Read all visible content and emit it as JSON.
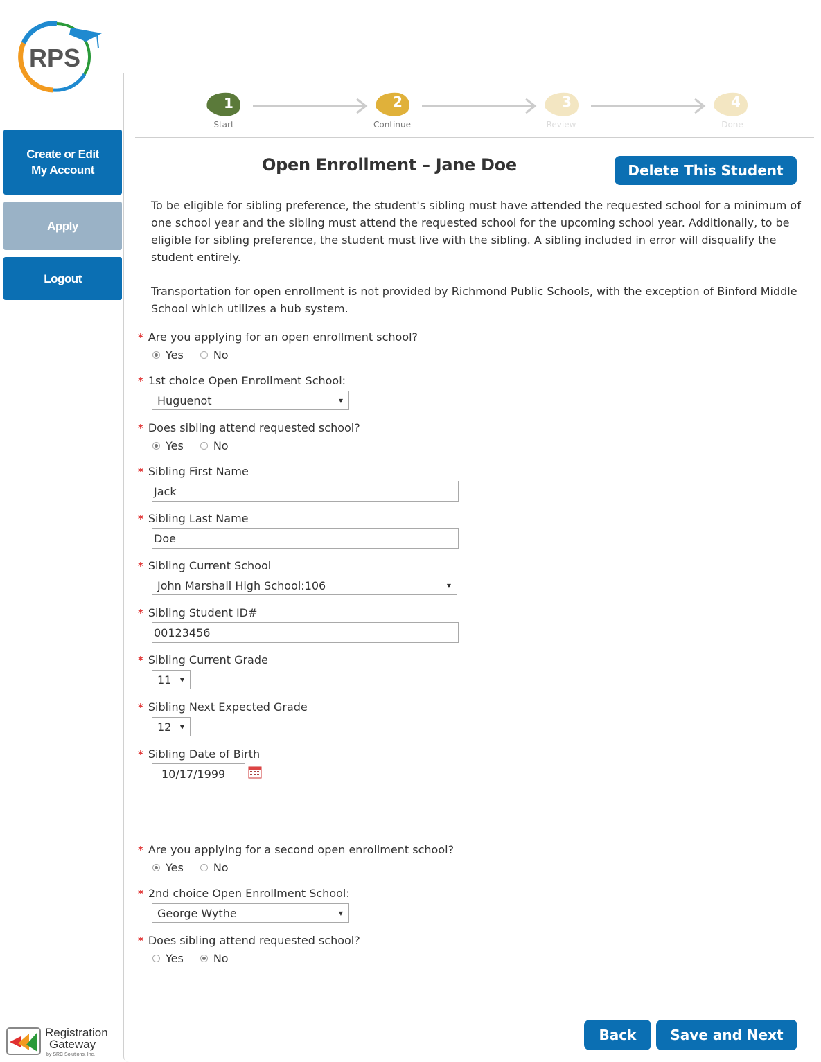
{
  "logo": {
    "text": "RPS"
  },
  "sidebar": {
    "create_edit": "Create or Edit My Account",
    "apply": "Apply",
    "logout": "Logout"
  },
  "footer_logo": {
    "line1": "Registration",
    "line2": "Gateway",
    "line3": "by SRC Solutions, Inc."
  },
  "steps": [
    {
      "num": "1",
      "label": "Start"
    },
    {
      "num": "2",
      "label": "Continue"
    },
    {
      "num": "3",
      "label": "Review"
    },
    {
      "num": "4",
      "label": "Done"
    }
  ],
  "page": {
    "title": "Open Enrollment – Jane Doe",
    "delete_button": "Delete This Student",
    "para1": "To be eligible for sibling preference, the student's sibling must have attended the requested school for a minimum of one school year and the sibling must attend the requested school for the upcoming school year. Additionally, to be eligible for sibling preference, the student must live with the sibling. A sibling included in error will disqualify the student entirely.",
    "para2": "Transportation for open enrollment is not provided by Richmond Public Schools, with the exception of Binford Middle School which utilizes a hub system."
  },
  "form": {
    "q_open_enrollment": "Are you applying for an open enrollment school?",
    "yes": "Yes",
    "no": "No",
    "q_first_choice": "1st choice Open Enrollment School:",
    "first_choice_value": "Huguenot",
    "q_sibling_attend": "Does sibling attend requested school?",
    "q_sibling_first": "Sibling First Name",
    "sibling_first_value": "Jack",
    "q_sibling_last": "Sibling Last Name",
    "sibling_last_value": "Doe",
    "q_sibling_school": "Sibling Current School",
    "sibling_school_value": "John Marshall High School:106",
    "q_sibling_id": "Sibling Student ID#",
    "sibling_id_value": "00123456",
    "q_sibling_grade": "Sibling Current Grade",
    "sibling_grade_value": "11",
    "q_sibling_next_grade": "Sibling Next Expected Grade",
    "sibling_next_grade_value": "12",
    "q_sibling_dob": "Sibling Date of Birth",
    "sibling_dob_value": "10/17/1999",
    "q_second_school": "Are you applying for a second open enrollment school?",
    "q_second_choice": "2nd choice Open Enrollment School:",
    "second_choice_value": "George Wythe"
  },
  "buttons": {
    "back": "Back",
    "save_next": "Save and Next"
  },
  "colors": {
    "primary": "#0b6fb3",
    "disabled": "#9ab2c6",
    "required": "#e03030"
  }
}
